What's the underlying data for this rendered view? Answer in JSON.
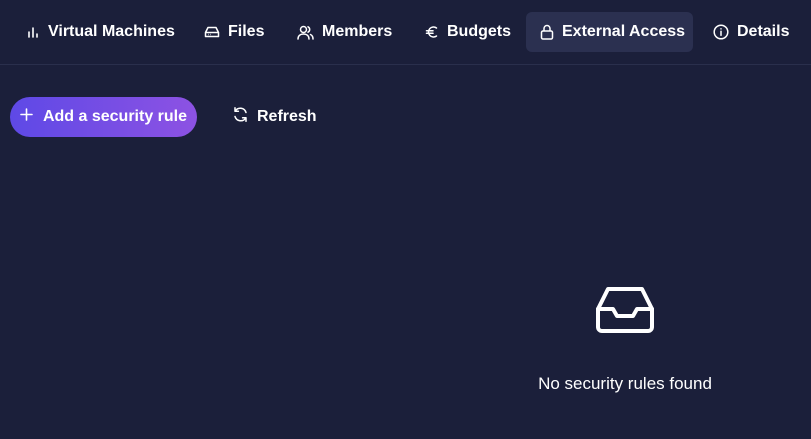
{
  "tabs": [
    {
      "label": "Virtual Machines",
      "icon": "bar-chart-icon",
      "active": false
    },
    {
      "label": "Files",
      "icon": "hard-drive-icon",
      "active": false
    },
    {
      "label": "Members",
      "icon": "users-icon",
      "active": false
    },
    {
      "label": "Budgets",
      "icon": "euro-icon",
      "active": false
    },
    {
      "label": "External Access",
      "icon": "lock-icon",
      "active": true
    },
    {
      "label": "Details",
      "icon": "info-icon",
      "active": false
    }
  ],
  "toolbar": {
    "add_label": "Add a security rule",
    "refresh_label": "Refresh"
  },
  "empty_state": {
    "icon": "inbox-icon",
    "message": "No security rules found"
  },
  "colors": {
    "background": "#1b1f3a",
    "active_tab": "#2b3050",
    "primary_gradient_start": "#5e49e6",
    "primary_gradient_end": "#8d52e3"
  }
}
